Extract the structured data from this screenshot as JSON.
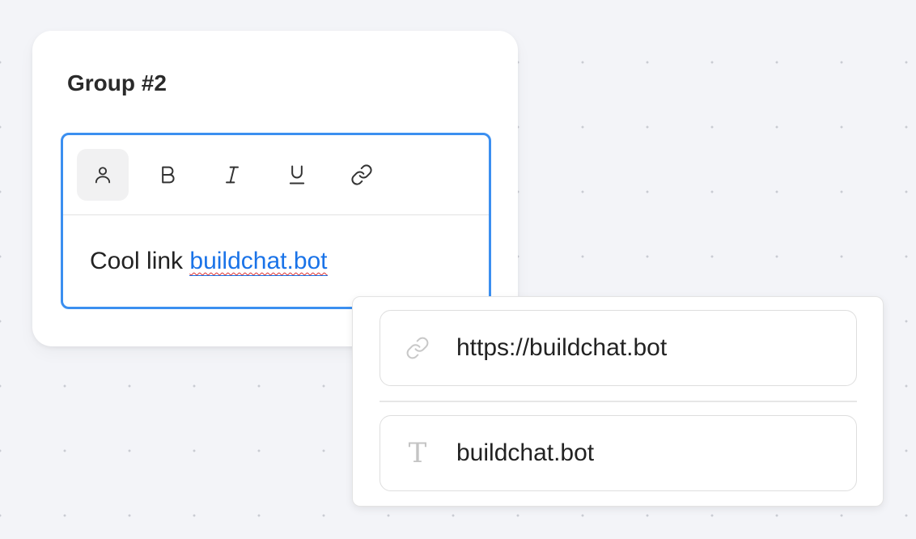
{
  "group": {
    "title": "Group #2"
  },
  "editor": {
    "toolbar": [
      {
        "name": "variable",
        "icon": "user-icon",
        "active": true
      },
      {
        "name": "bold",
        "icon": "bold-icon",
        "label": "B"
      },
      {
        "name": "italic",
        "icon": "italic-icon",
        "label": "I"
      },
      {
        "name": "underline",
        "icon": "underline-icon",
        "label": "U"
      },
      {
        "name": "link",
        "icon": "link-icon"
      }
    ],
    "content": {
      "text": "Cool link ",
      "link_text": "buildchat.bot"
    },
    "accent_color": "#3b8ff0"
  },
  "link_popover": {
    "url_icon": "link-icon",
    "url_value": "https://buildchat.bot",
    "text_icon": "text-icon",
    "text_icon_glyph": "T",
    "text_value": "buildchat.bot"
  }
}
